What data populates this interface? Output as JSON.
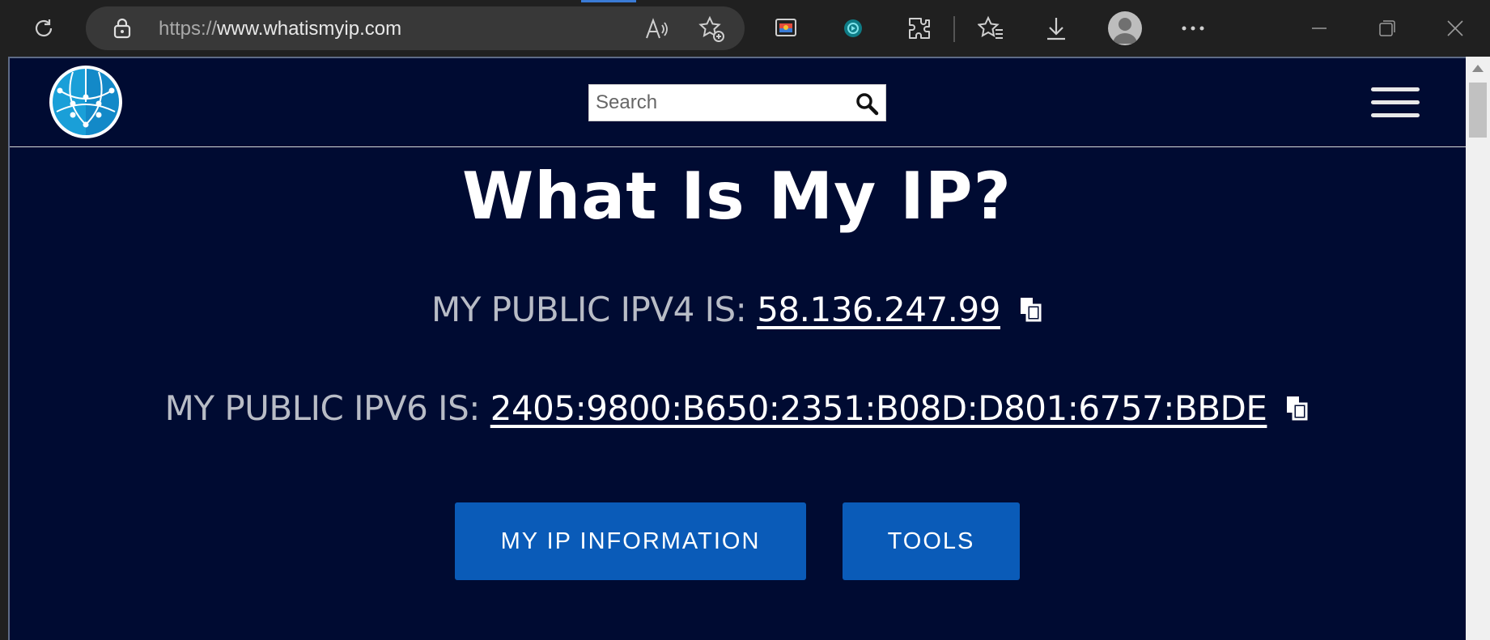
{
  "browser": {
    "url_scheme": "https://",
    "url_host": "www.whatismyip.com",
    "icons": [
      "refresh-icon",
      "lock-icon",
      "read-aloud-icon",
      "add-favorite-icon",
      "collections-icon",
      "extension-teal-icon",
      "extensions-icon",
      "favorites-icon",
      "download-icon",
      "profile-avatar",
      "more-icon",
      "minimize-icon",
      "restore-icon",
      "close-icon"
    ]
  },
  "site": {
    "search_placeholder": "Search",
    "title": "What Is My IP?",
    "ipv4_label": "MY PUBLIC IPV4 IS: ",
    "ipv4_value": "58.136.247.99",
    "ipv6_label": "MY PUBLIC IPV6 IS: ",
    "ipv6_value": "2405:9800:B650:2351:B08D:D801:6757:BBDE",
    "button_info": "MY IP INFORMATION",
    "button_tools": "TOOLS"
  },
  "colors": {
    "page_background": "#000b32",
    "button_background": "#0a5bb8",
    "browser_chrome": "#202020"
  }
}
